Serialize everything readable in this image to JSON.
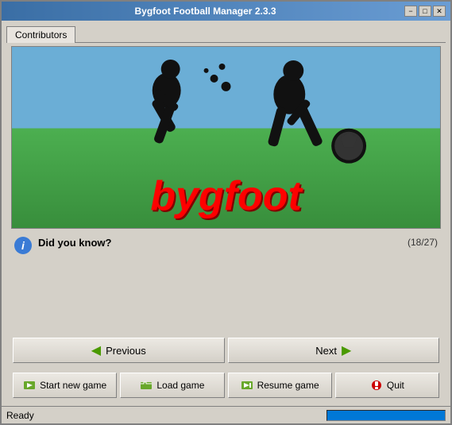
{
  "window": {
    "title": "Bygfoot Football Manager 2.3.3",
    "controls": {
      "minimize": "−",
      "maximize": "□",
      "close": "✕"
    }
  },
  "tabs": [
    {
      "label": "Contributors"
    }
  ],
  "logo": {
    "text": "bygfoot"
  },
  "did_you_know": {
    "label": "Did you know?",
    "count": "(18/27)",
    "info_icon": "i"
  },
  "nav_buttons": {
    "previous": "Previous",
    "next": "Next"
  },
  "action_buttons": {
    "start_new_game": "Start new game",
    "load_game": "Load game",
    "resume_game": "Resume game",
    "quit": "Quit"
  },
  "status": {
    "text": "Ready"
  }
}
